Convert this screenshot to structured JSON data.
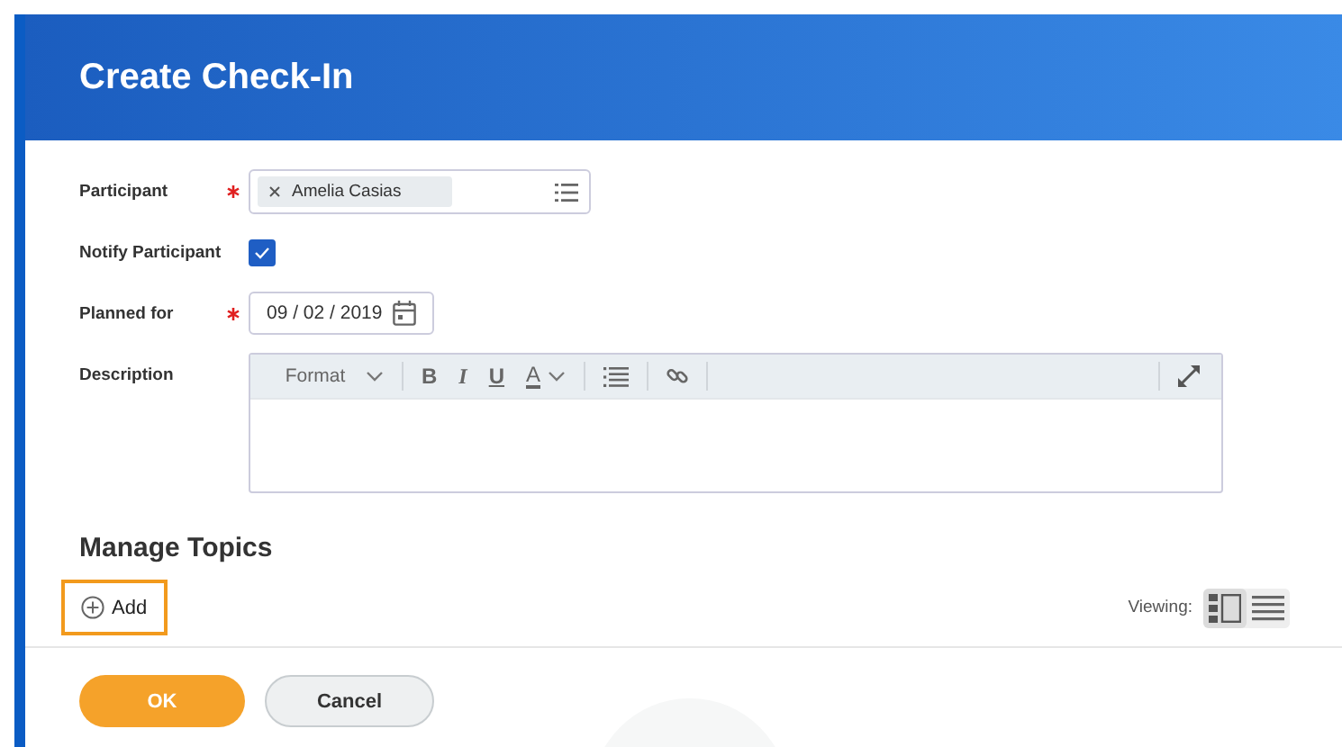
{
  "window": {
    "title": "Create Check-In"
  },
  "fields": [
    {
      "kind": "tags",
      "label": "Participant",
      "required": true,
      "tags": [
        "Amelia Casias"
      ]
    },
    {
      "kind": "checkbox",
      "label": "Notify Participant",
      "required": false,
      "checked": true
    },
    {
      "kind": "date",
      "label": "Planned for",
      "required": true,
      "value": "09 / 02 / 2019"
    },
    {
      "kind": "editor",
      "label": "Description",
      "required": false,
      "toolbar": [
        {
          "kind": "dropdown",
          "label": "Format"
        },
        {
          "kind": "bold",
          "label": "B"
        },
        {
          "kind": "italic",
          "label": "I"
        },
        {
          "kind": "underline",
          "label": "U"
        },
        {
          "kind": "color",
          "label": "A"
        }
      ]
    }
  ],
  "topics": {
    "heading": "Manage Topics",
    "add": {
      "label": "Add",
      "focused": true
    },
    "viewing_label": "Viewing:",
    "views": [
      {
        "kind": "detail",
        "selected": true
      },
      {
        "kind": "list",
        "selected": false
      }
    ]
  },
  "buttons": [
    {
      "kind": "primary",
      "label": "OK"
    },
    {
      "kind": "secondary",
      "label": "Cancel"
    }
  ]
}
